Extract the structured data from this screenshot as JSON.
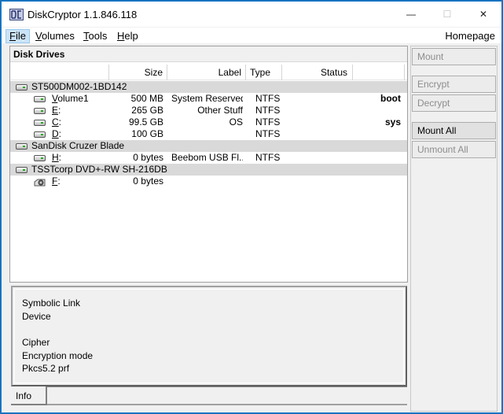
{
  "window": {
    "title": "DiskCryptor 1.1.846.118",
    "controls": {
      "minimize": "—",
      "maximize": "☐",
      "close": "✕"
    }
  },
  "menu": {
    "items": [
      {
        "label": "File",
        "mnemonic": "F",
        "rest": "ile",
        "active": true
      },
      {
        "label": "Volumes",
        "mnemonic": "V",
        "rest": "olumes"
      },
      {
        "label": "Tools",
        "mnemonic": "T",
        "rest": "ools"
      },
      {
        "label": "Help",
        "mnemonic": "H",
        "rest": "elp"
      }
    ],
    "homepage": "Homepage"
  },
  "drives": {
    "header": "Disk Drives",
    "columns": [
      "",
      "Size",
      "Label",
      "Type",
      "Status",
      ""
    ],
    "rows": [
      {
        "kind": "disk",
        "name": "ST500DM002-1BD142"
      },
      {
        "kind": "volume",
        "icon": "hdd",
        "name": "Volume1",
        "size": "500 MB",
        "label": "System Reserved",
        "type": "NTFS",
        "status": "",
        "flag": "boot"
      },
      {
        "kind": "volume",
        "icon": "hdd",
        "name": "E:",
        "size": "265 GB",
        "label": "Other Stuff",
        "type": "NTFS",
        "status": "",
        "flag": ""
      },
      {
        "kind": "volume",
        "icon": "hdd",
        "name": "C:",
        "size": "99.5 GB",
        "label": "OS",
        "type": "NTFS",
        "status": "",
        "flag": "sys"
      },
      {
        "kind": "volume",
        "icon": "hdd",
        "name": "D:",
        "size": "100 GB",
        "label": "",
        "type": "NTFS",
        "status": "",
        "flag": ""
      },
      {
        "kind": "disk",
        "name": "SanDisk Cruzer Blade"
      },
      {
        "kind": "volume",
        "icon": "hdd",
        "name": "H:",
        "size": "0 bytes",
        "label": "Beebom USB Fl...",
        "type": "NTFS",
        "status": "",
        "flag": ""
      },
      {
        "kind": "disk",
        "name": "TSSTcorp DVD+-RW SH-216DB"
      },
      {
        "kind": "volume",
        "icon": "cdrom",
        "name": "F:",
        "size": "0 bytes",
        "label": "",
        "type": "",
        "status": "",
        "flag": ""
      }
    ]
  },
  "buttons": {
    "mount": "Mount",
    "encrypt": "Encrypt",
    "decrypt": "Decrypt",
    "mount_all": "Mount All",
    "unmount_all": "Unmount All"
  },
  "info": {
    "symbolic_link": "Symbolic Link",
    "device": "Device",
    "cipher": "Cipher",
    "encryption_mode": "Encryption mode",
    "pkcs": "Pkcs5.2 prf",
    "tab": "Info"
  }
}
